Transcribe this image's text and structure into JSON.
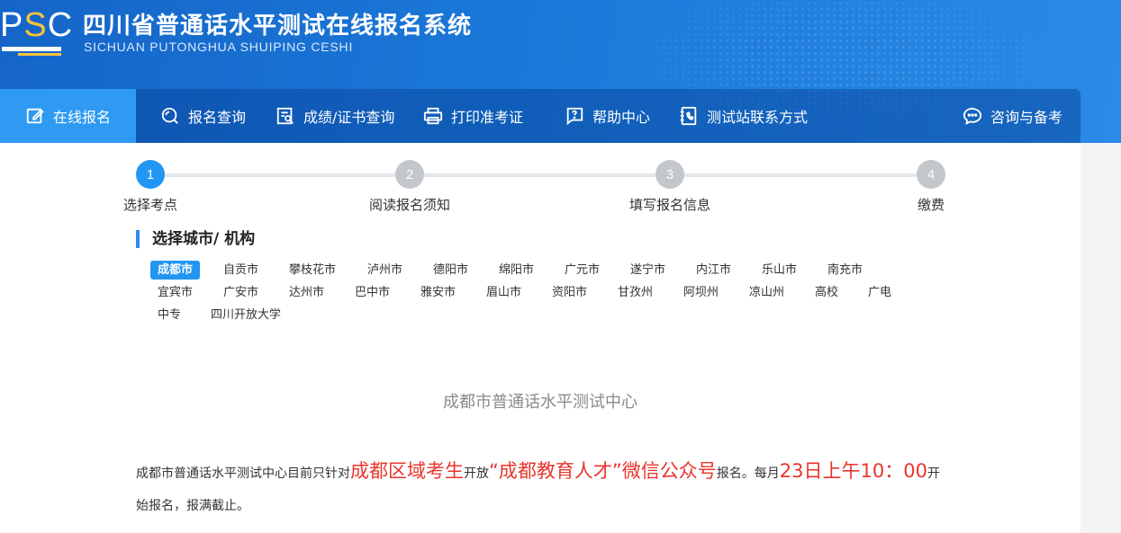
{
  "header": {
    "logo_text_p": "P",
    "logo_text_s": "S",
    "logo_text_c": "C",
    "title": "四川省普通话水平测试在线报名系统",
    "subtitle": "SICHUAN PUTONGHUA SHUIPING CESHI"
  },
  "nav": {
    "items": [
      {
        "label": "在线报名",
        "icon": "edit-icon"
      },
      {
        "label": "报名查询",
        "icon": "search-icon"
      },
      {
        "label": "成绩/证书查询",
        "icon": "certificate-search-icon"
      },
      {
        "label": "打印准考证",
        "icon": "printer-icon"
      },
      {
        "label": "帮助中心",
        "icon": "help-icon"
      },
      {
        "label": "测试站联系方式",
        "icon": "contact-book-icon"
      },
      {
        "label": "咨询与备考",
        "icon": "chat-icon"
      }
    ]
  },
  "steps": [
    {
      "num": "1",
      "label": "选择考点",
      "active": true
    },
    {
      "num": "2",
      "label": "阅读报名须知",
      "active": false
    },
    {
      "num": "3",
      "label": "填写报名信息",
      "active": false
    },
    {
      "num": "4",
      "label": "缴费",
      "active": false
    }
  ],
  "section": {
    "title": "选择城市/ 机构"
  },
  "cities": [
    "成都市",
    "自贡市",
    "攀枝花市",
    "泸州市",
    "德阳市",
    "绵阳市",
    "广元市",
    "遂宁市",
    "内江市",
    "乐山市",
    "南充市",
    "宜宾市",
    "广安市",
    "达州市",
    "巴中市",
    "雅安市",
    "眉山市",
    "资阳市",
    "甘孜州",
    "阿坝州",
    "凉山州",
    "高校",
    "广电",
    "中专",
    "四川开放大学"
  ],
  "selected_city": "成都市",
  "center": {
    "title": "成都市普通话水平测试中心"
  },
  "notice": {
    "p1": "成都市普通话水平测试中心目前只针对",
    "h1": "成都区域考生",
    "p2": "开放",
    "h2": "“成都教育人才”微信公众号",
    "p3": "报名。每月",
    "h3": "23日上午10：00",
    "p4": "开始报名，报满截止。"
  },
  "colors": {
    "primary": "#2196f3",
    "header_bg": "#1a78d8",
    "highlight_red": "#e8352c",
    "logo_yellow": "#f5c33b"
  }
}
